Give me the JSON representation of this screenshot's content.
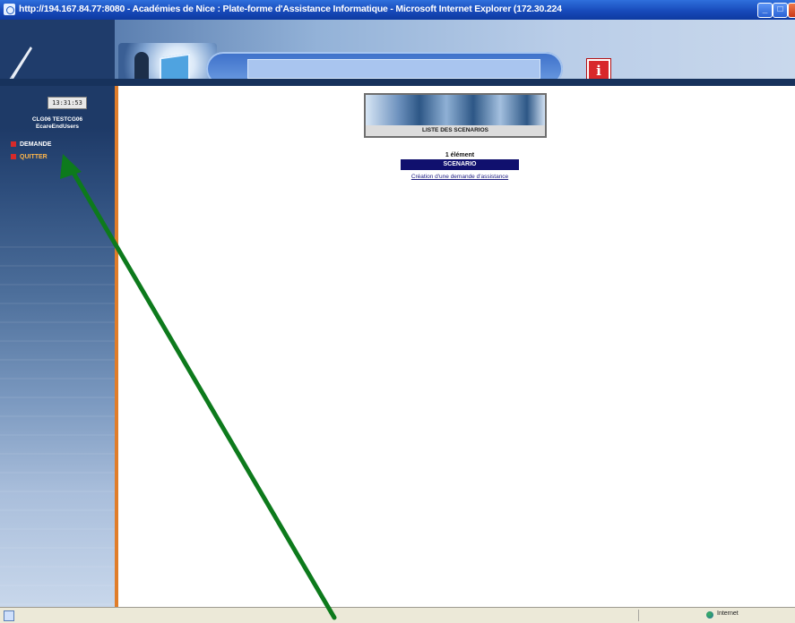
{
  "window": {
    "title": "http://194.167.84.77:8080 - Académies de Nice : Plate-forme d'Assistance Informatique - Microsoft Internet Explorer (172.30.224"
  },
  "sidebar": {
    "clock": "13:31:53",
    "user_line1": "CLG06 TESTCG06",
    "user_line2": "EcareEndUsers",
    "items": [
      {
        "label": "DEMANDE"
      },
      {
        "label": "QUITTER"
      }
    ]
  },
  "main": {
    "banner_caption": "LISTE DES SCENARIOS",
    "count": "1 élément",
    "column_header": "SCENARIO",
    "rows": [
      {
        "scenario": "Création d'une demande d'assistance"
      }
    ]
  },
  "statusbar": {
    "zone": "Internet"
  },
  "colors": {
    "arrow": "#0d7a1c",
    "sidebar_border": "#e07d2a",
    "table_header": "#10106e",
    "info_icon": "#d8282b"
  },
  "icons": {
    "header_logo": "quill-icon",
    "header_info": "info-icon",
    "menu_bullet": "red-square-icon",
    "status_zone": "globe-icon"
  }
}
